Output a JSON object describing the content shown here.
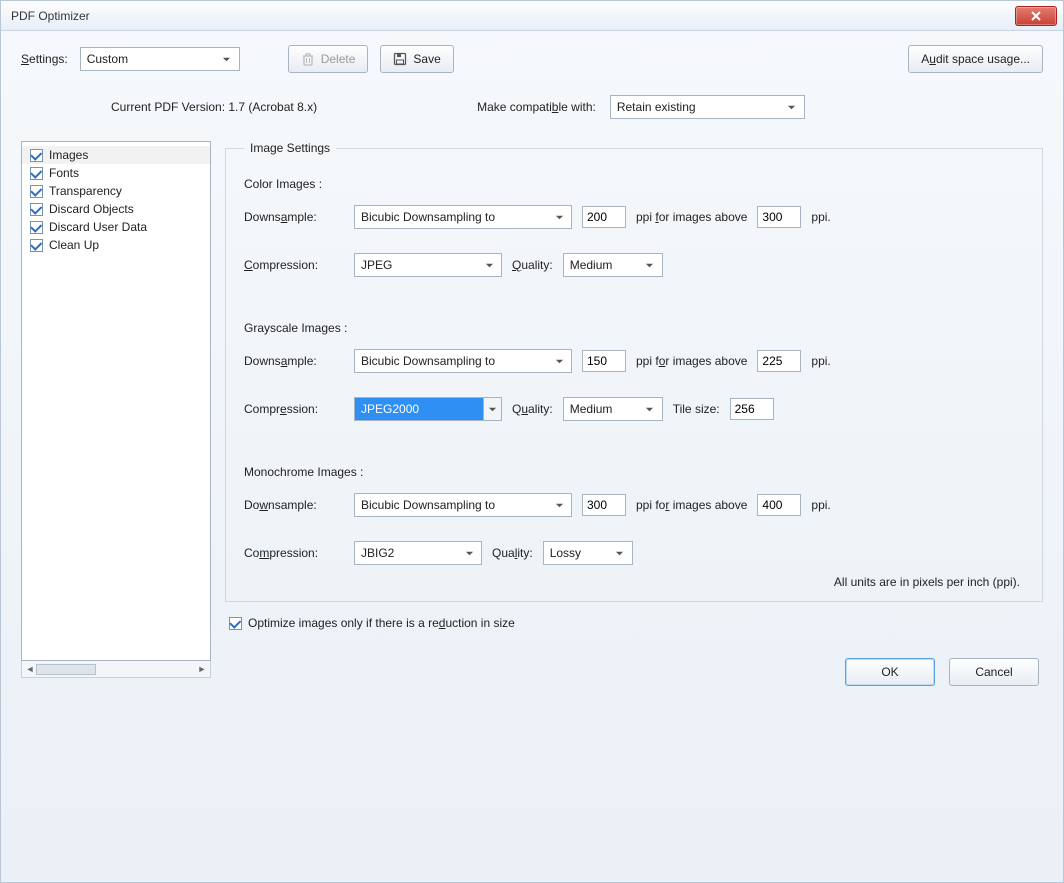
{
  "title": "PDF Optimizer",
  "toolbar": {
    "settings_label": "Settings:",
    "settings_value": "Custom",
    "delete_label": "Delete",
    "save_label": "Save",
    "audit_label": "Audit space usage..."
  },
  "info": {
    "current_version": "Current PDF Version: 1.7 (Acrobat 8.x)",
    "compat_label": "Make compatible with:",
    "compat_value": "Retain existing"
  },
  "sidebar": {
    "items": [
      {
        "label": "Images",
        "checked": true,
        "selected": true
      },
      {
        "label": "Fonts",
        "checked": true
      },
      {
        "label": "Transparency",
        "checked": true
      },
      {
        "label": "Discard Objects",
        "checked": true
      },
      {
        "label": "Discard User Data",
        "checked": true
      },
      {
        "label": "Clean Up",
        "checked": true
      }
    ]
  },
  "panel": {
    "legend": "Image Settings",
    "color": {
      "title": "Color Images :",
      "downsample_label": "Downsample:",
      "downsample_value": "Bicubic Downsampling to",
      "ppi": "200",
      "above_label": "ppi for images above",
      "above": "300",
      "ppi_suffix": "ppi.",
      "compression_label": "Compression:",
      "compression_value": "JPEG",
      "quality_label": "Quality:",
      "quality_value": "Medium"
    },
    "gray": {
      "title": "Grayscale Images :",
      "downsample_label": "Downsample:",
      "downsample_value": "Bicubic Downsampling to",
      "ppi": "150",
      "above_label": "ppi for images above",
      "above": "225",
      "ppi_suffix": "ppi.",
      "compression_label": "Compression:",
      "compression_value": "JPEG2000",
      "quality_label": "Quality:",
      "quality_value": "Medium",
      "tile_label": "Tile size:",
      "tile": "256"
    },
    "mono": {
      "title": "Monochrome Images :",
      "downsample_label": "Downsample:",
      "downsample_value": "Bicubic Downsampling to",
      "ppi": "300",
      "above_label": "ppi for images above",
      "above": "400",
      "ppi_suffix": "ppi.",
      "compression_label": "Compression:",
      "compression_value": "JBIG2",
      "quality_label": "Quality:",
      "quality_value": "Lossy"
    },
    "note": "All units are in pixels per inch (ppi).",
    "optimize_label": "Optimize images only if there is a reduction in size",
    "optimize_checked": true
  },
  "buttons": {
    "ok": "OK",
    "cancel": "Cancel"
  }
}
